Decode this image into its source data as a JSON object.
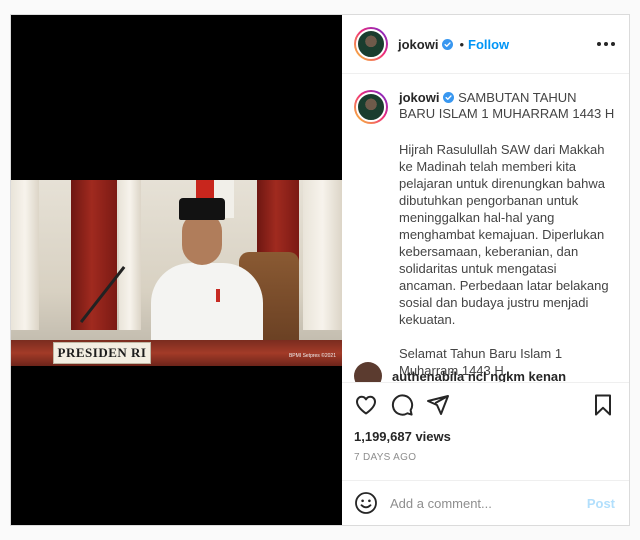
{
  "post": {
    "username": "jokowi",
    "follow_label": "Follow",
    "caption": {
      "title": "SAMBUTAN TAHUN BARU ISLAM 1 MUHARRAM 1443 H",
      "paragraphs": [
        "Hijrah Rasulullah SAW dari Makkah ke Madinah telah memberi kita pelajaran untuk direnungkan bahwa dibutuhkan pengorbanan untuk meninggalkan hal-hal yang menghambat kemajuan. Diperlukan kebersamaan, keberanian, dan solidaritas untuk mengatasi ancaman. Perbedaan latar belakang sosial dan budaya justru menjadi kekuatan.",
        "Selamat Tahun Baru Islam 1 Muharram 1443 H."
      ],
      "relative_time": "1w"
    },
    "comment_peek": "authenabila ncl ngkm kenan",
    "views": "1,199,687 views",
    "date": "7 DAYS AGO",
    "comment_placeholder": "Add a comment...",
    "post_label": "Post",
    "photo": {
      "nameplate": "PRESIDEN RI",
      "credit": "BPMI Setpres ©2021"
    }
  },
  "colors": {
    "accent": "#0095f6",
    "post_disabled": "#b2dffc",
    "muted": "#8e8e8e"
  },
  "icons": [
    "verified-badge-icon",
    "more-options-icon",
    "heart-icon",
    "comment-icon",
    "share-icon",
    "bookmark-icon",
    "emoji-icon"
  ]
}
